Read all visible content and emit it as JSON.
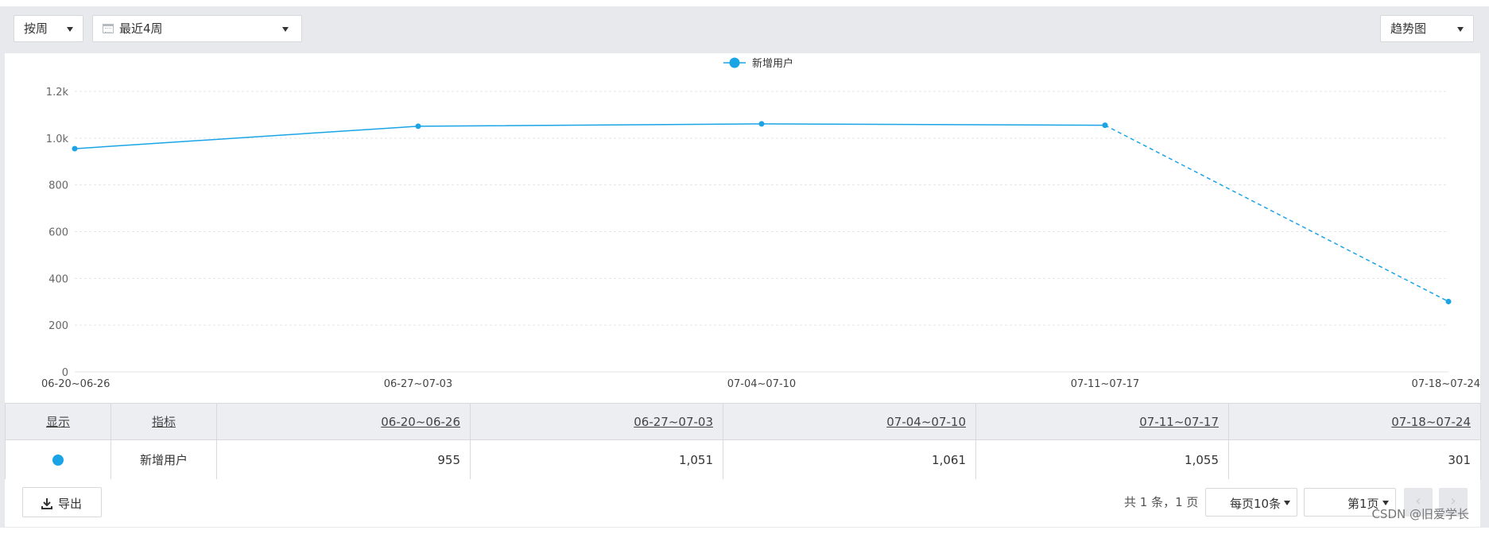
{
  "toolbar": {
    "period_label": "按周",
    "range_label": "最近4周",
    "view_label": "趋势图"
  },
  "chart_data": {
    "type": "line",
    "categories": [
      "06-20~06-26",
      "06-27~07-03",
      "07-04~07-10",
      "07-11~07-17",
      "07-18~07-24"
    ],
    "series": [
      {
        "name": "新增用户",
        "values": [
          955,
          1051,
          1061,
          1055,
          301
        ],
        "incomplete_last": true
      }
    ],
    "ylim": [
      0,
      1200
    ],
    "yticks": [
      0,
      200,
      400,
      600,
      800,
      1000,
      1200
    ],
    "ytick_labels": [
      "0",
      "200",
      "400",
      "600",
      "800",
      "1.0k",
      "1.2k"
    ],
    "grid": true,
    "legend": "top-center",
    "color": "#1aa4e6"
  },
  "table": {
    "headers": [
      "显示",
      "指标",
      "06-20~06-26",
      "06-27~07-03",
      "07-04~07-10",
      "07-11~07-17",
      "07-18~07-24"
    ],
    "row": {
      "metric": "新增用户",
      "values": [
        "955",
        "1,051",
        "1,061",
        "1,055",
        "301"
      ]
    }
  },
  "footer": {
    "export_label": "导出",
    "summary": "共 1 条，1 页",
    "page_size_label": "每页10条",
    "page_label": "第1页",
    "prev_icon": "‹",
    "next_icon": "›",
    "watermark": "CSDN @旧爱学长"
  }
}
